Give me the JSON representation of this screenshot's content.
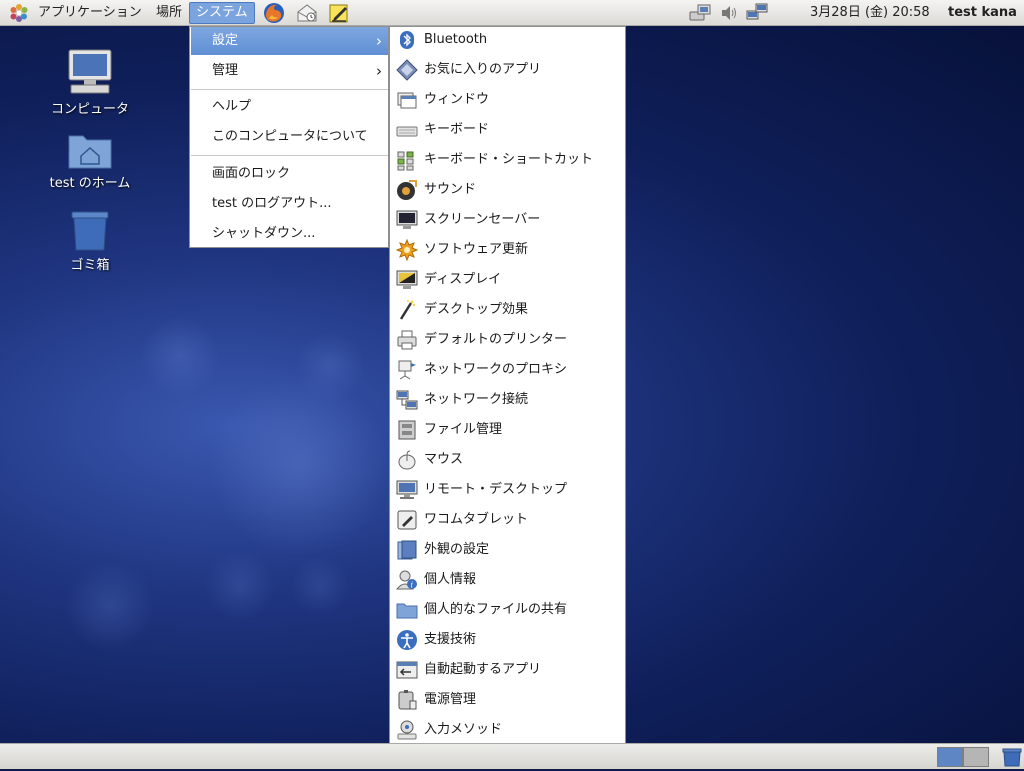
{
  "top_panel": {
    "menus": {
      "applications": "アプリケーション",
      "places": "場所",
      "system": "システム"
    },
    "clock": "3月28日 (金) 20:58",
    "username": "test kana"
  },
  "desktop_icons": [
    {
      "label": "コンピュータ"
    },
    {
      "label": "test のホーム"
    },
    {
      "label": "ゴミ箱"
    }
  ],
  "system_menu": {
    "items": [
      {
        "label": "設定",
        "submenu": true,
        "selected": true
      },
      {
        "label": "管理",
        "submenu": true
      },
      {
        "label": "ヘルプ"
      },
      {
        "label": "このコンピュータについて"
      },
      {
        "label": "画面のロック"
      },
      {
        "label": "test のログアウト..."
      },
      {
        "label": "シャットダウン..."
      }
    ]
  },
  "settings_menu": {
    "items": [
      {
        "label": "Bluetooth",
        "icon": "bluetooth-icon"
      },
      {
        "label": "お気に入りのアプリ",
        "icon": "favorite-apps-icon"
      },
      {
        "label": "ウィンドウ",
        "icon": "window-icon"
      },
      {
        "label": "キーボード",
        "icon": "keyboard-icon"
      },
      {
        "label": "キーボード・ショートカット",
        "icon": "keyboard-shortcut-icon"
      },
      {
        "label": "サウンド",
        "icon": "sound-icon"
      },
      {
        "label": "スクリーンセーバー",
        "icon": "screensaver-icon"
      },
      {
        "label": "ソフトウェア更新",
        "icon": "software-update-icon"
      },
      {
        "label": "ディスプレイ",
        "icon": "display-icon"
      },
      {
        "label": "デスクトップ効果",
        "icon": "desktop-effects-icon"
      },
      {
        "label": "デフォルトのプリンター",
        "icon": "printer-icon"
      },
      {
        "label": "ネットワークのプロキシ",
        "icon": "network-proxy-icon"
      },
      {
        "label": "ネットワーク接続",
        "icon": "network-connections-icon"
      },
      {
        "label": "ファイル管理",
        "icon": "file-management-icon"
      },
      {
        "label": "マウス",
        "icon": "mouse-icon"
      },
      {
        "label": "リモート・デスクトップ",
        "icon": "remote-desktop-icon"
      },
      {
        "label": "ワコムタブレット",
        "icon": "wacom-tablet-icon"
      },
      {
        "label": "外観の設定",
        "icon": "appearance-icon"
      },
      {
        "label": "個人情報",
        "icon": "personal-info-icon"
      },
      {
        "label": "個人的なファイルの共有",
        "icon": "file-sharing-icon"
      },
      {
        "label": "支援技術",
        "icon": "accessibility-icon"
      },
      {
        "label": "自動起動するアプリ",
        "icon": "startup-apps-icon"
      },
      {
        "label": "電源管理",
        "icon": "power-management-icon"
      },
      {
        "label": "入力メソッド",
        "icon": "input-method-icon"
      }
    ]
  }
}
